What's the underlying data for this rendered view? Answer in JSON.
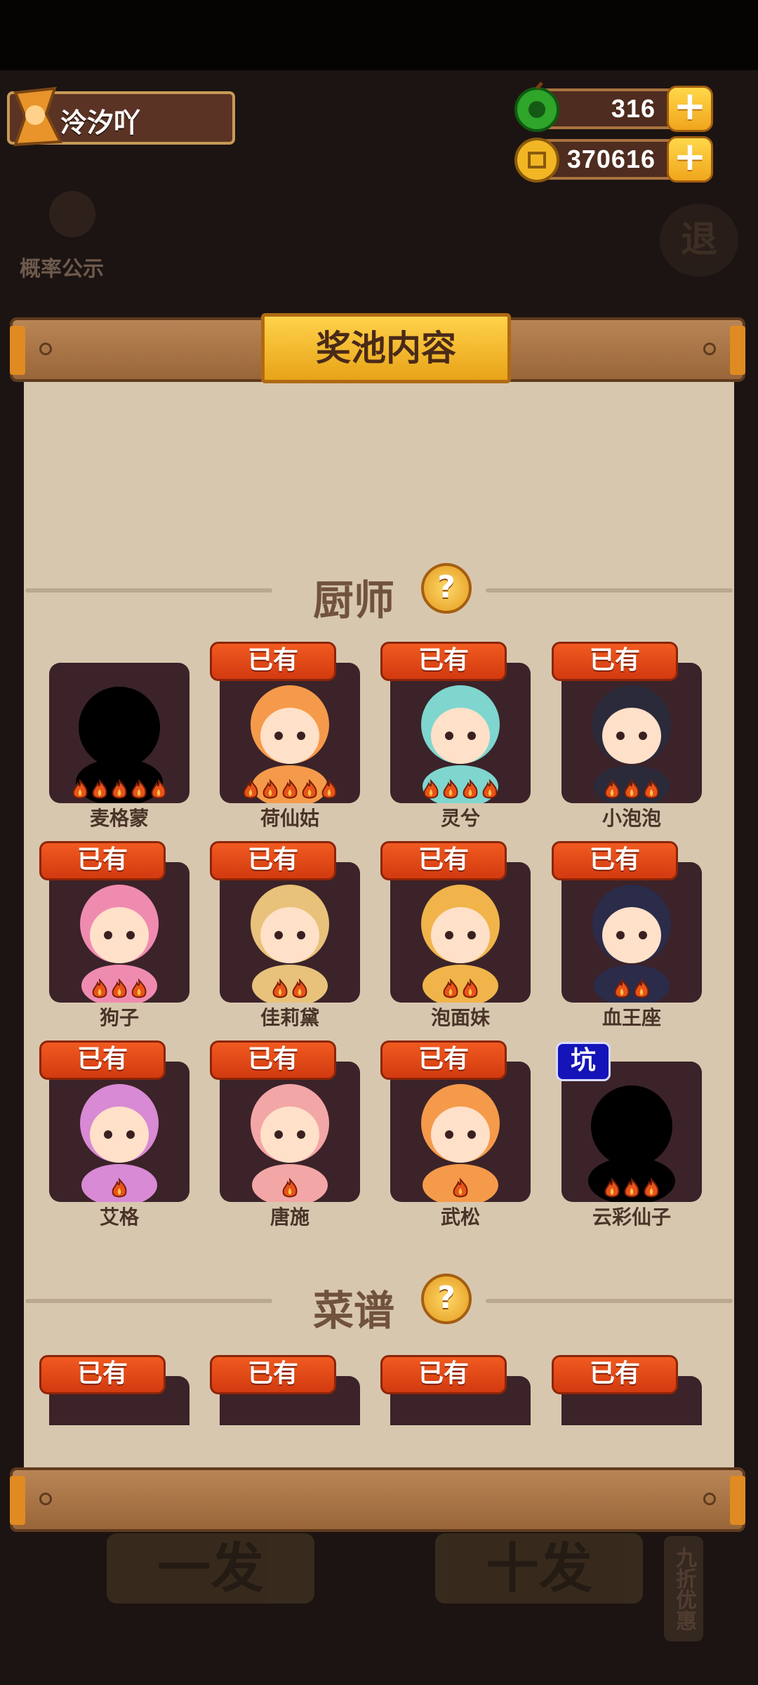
{
  "player": {
    "name": "泠汐吖"
  },
  "currencies": [
    {
      "icon": "green-gem-icon",
      "value": "316"
    },
    {
      "icon": "gold-coin-icon",
      "value": "370616"
    }
  ],
  "probability_label": "概率公示",
  "exit_label": "退",
  "panel": {
    "title": "奖池内容"
  },
  "sections": {
    "chefs": {
      "title": "厨师"
    },
    "recipes": {
      "title": "菜谱"
    }
  },
  "chefs": [
    {
      "name": "麦格蒙",
      "badge": "",
      "flames": 5,
      "silhouette": true
    },
    {
      "name": "荷仙姑",
      "badge": "已有",
      "flames": 5
    },
    {
      "name": "灵兮",
      "badge": "已有",
      "flames": 4
    },
    {
      "name": "小泡泡",
      "badge": "已有",
      "flames": 3
    },
    {
      "name": "狗子",
      "badge": "已有",
      "flames": 3
    },
    {
      "name": "佳莉黛",
      "badge": "已有",
      "flames": 2
    },
    {
      "name": "泡面妹",
      "badge": "已有",
      "flames": 2
    },
    {
      "name": "血王座",
      "badge": "已有",
      "flames": 2
    },
    {
      "name": "艾格",
      "badge": "已有",
      "flames": 1
    },
    {
      "name": "唐施",
      "badge": "已有",
      "flames": 1
    },
    {
      "name": "武松",
      "badge": "已有",
      "flames": 1
    },
    {
      "name": "云彩仙子",
      "badge": "坑",
      "flames": 3,
      "silhouette": true
    }
  ],
  "recipes": [
    {
      "badge": "已有"
    },
    {
      "badge": "已有"
    },
    {
      "badge": "已有"
    },
    {
      "badge": "已有"
    }
  ],
  "bottom_buttons": {
    "single": "一发",
    "ten": "十发",
    "discount": "九折优惠"
  },
  "colors": {
    "owned_badge": "#e24a16",
    "pit_badge": "#1414b8",
    "panel_paper": "#d8c7af",
    "card_bg": "#3b2329"
  }
}
